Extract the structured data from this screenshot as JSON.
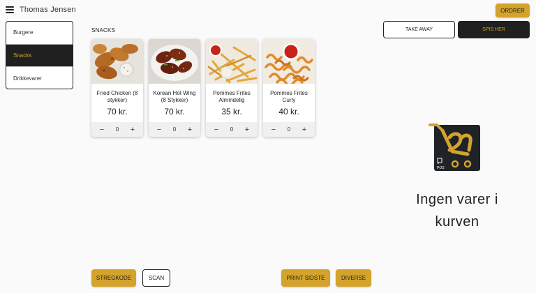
{
  "header": {
    "user_name": "Thomas Jensen",
    "orders_label": "ORDRER"
  },
  "categories": [
    {
      "label": "Burgere",
      "active": false
    },
    {
      "label": "Snacks",
      "active": true
    },
    {
      "label": "Drikkevarer",
      "active": false
    }
  ],
  "section_title": "SNACKS",
  "products": [
    {
      "name": "Fried Chicken (8 stykker)",
      "price": "70 kr.",
      "qty": "0",
      "minus": "−",
      "plus": "+"
    },
    {
      "name": "Korean Hot Wing (8 Stykker)",
      "price": "70 kr.",
      "qty": "0",
      "minus": "−",
      "plus": "+"
    },
    {
      "name": "Pommes Frites Almindelig",
      "price": "35 kr.",
      "qty": "0",
      "minus": "−",
      "plus": "+"
    },
    {
      "name": "Pommes Frites Curly",
      "price": "40 kr.",
      "qty": "0",
      "minus": "−",
      "plus": "+"
    }
  ],
  "order_type": {
    "take_away": "TAKE AWAY",
    "eat_here": "SPIS HER",
    "selected": "SPIS HER"
  },
  "cart": {
    "logo_text": "POS",
    "empty_message": "Ingen varer i kurven"
  },
  "bottom_bar": {
    "barcode": "STREGKODE",
    "scan": "SCAN",
    "print_last": "PRINT SIDSTE",
    "misc": "DIVERSE"
  },
  "colors": {
    "accent": "#d4a32b",
    "dark": "#202020",
    "background": "#fafafa"
  }
}
